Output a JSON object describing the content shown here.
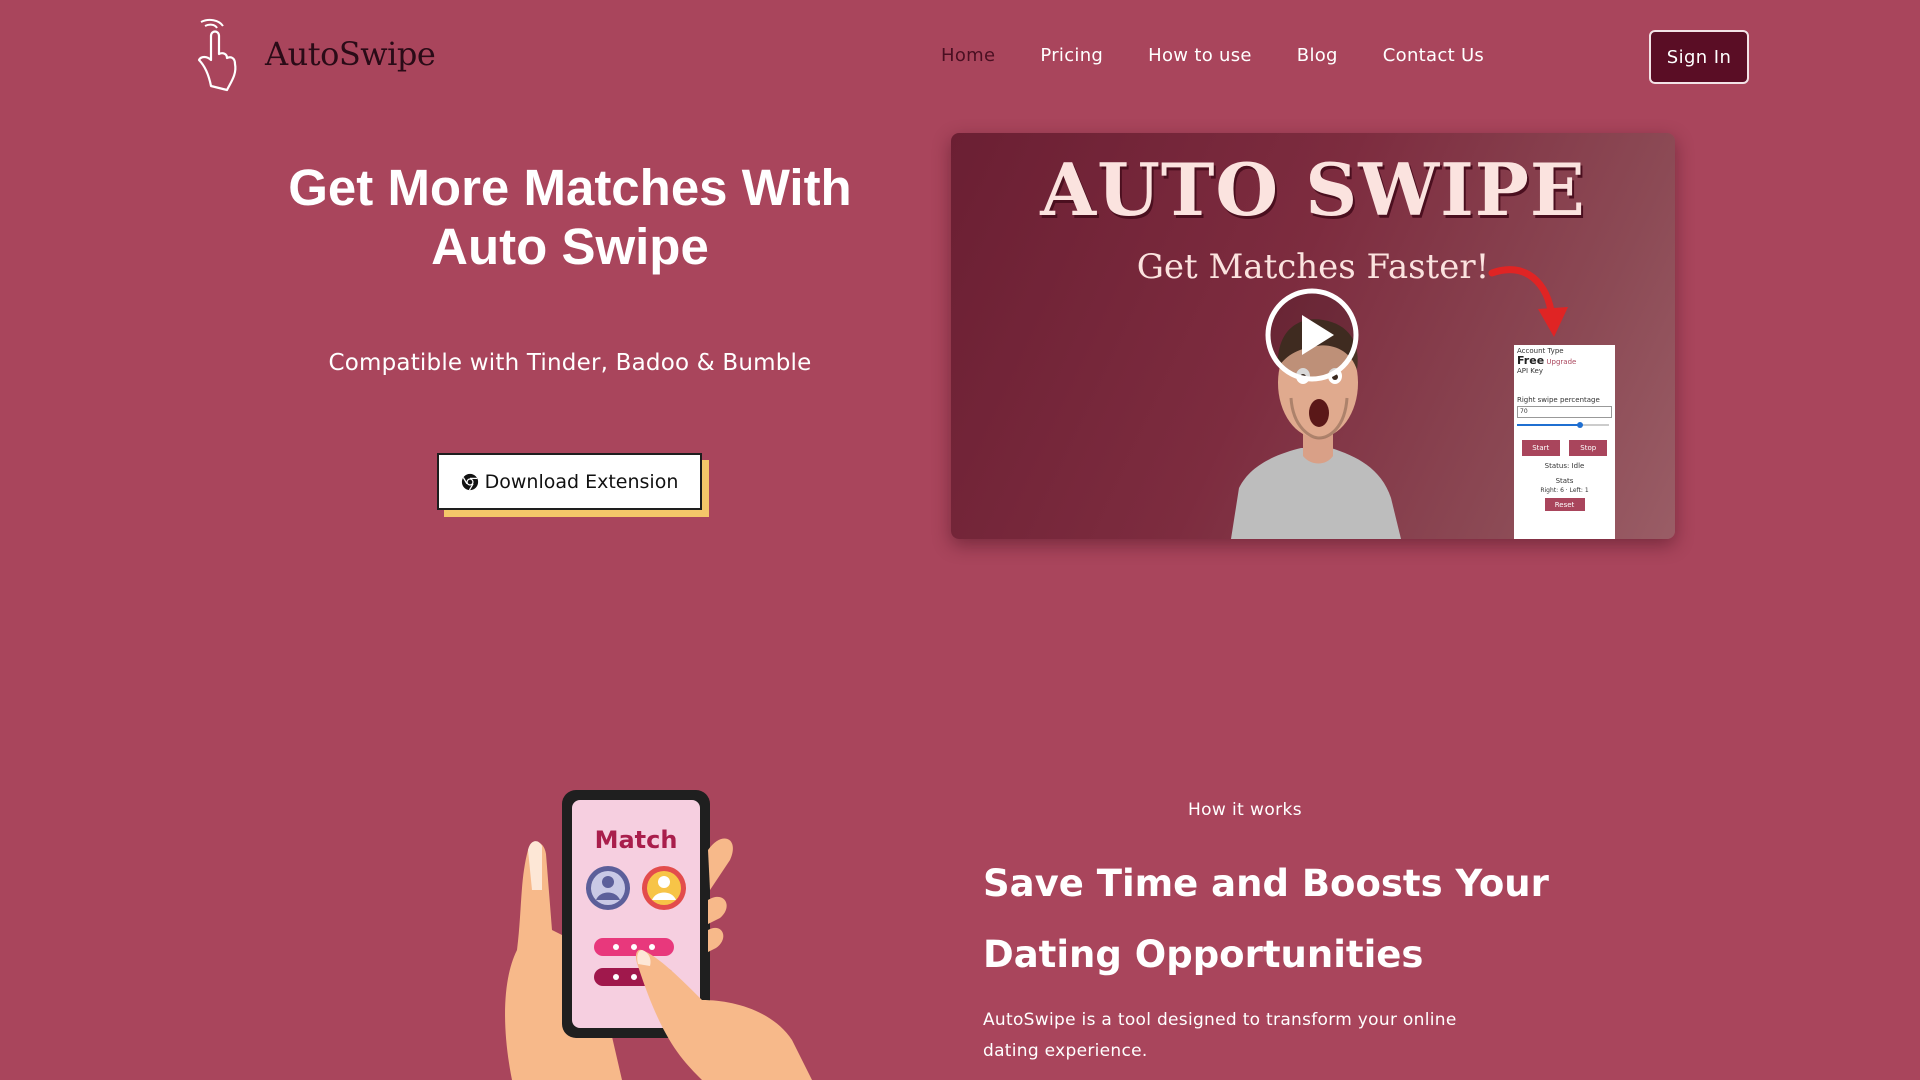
{
  "brand": {
    "name": "AutoSwipe",
    "logo_icon": "tap-hand-icon"
  },
  "nav": {
    "items": [
      {
        "label": "Home",
        "active": true
      },
      {
        "label": "Pricing",
        "active": false
      },
      {
        "label": "How to use",
        "active": false
      },
      {
        "label": "Blog",
        "active": false
      },
      {
        "label": "Contact Us",
        "active": false
      }
    ],
    "signin_label": "Sign In"
  },
  "hero": {
    "title": "Get More Matches With Auto Swipe",
    "compatible": "Compatible with Tinder, Badoo & Bumble",
    "download_label": "Download Extension",
    "download_icon": "chrome-icon"
  },
  "video": {
    "title": "AUTO SWIPE",
    "subtitle": "Get Matches Faster!",
    "play_icon": "play-icon",
    "panel": {
      "account_type_label": "Account Type",
      "plan": "Free",
      "upgrade": "Upgrade",
      "api_key_label": "API Key",
      "right_swipe_label": "Right swipe percentage",
      "right_swipe_value": "70",
      "slider_level": 0.7,
      "start_label": "Start",
      "stop_label": "Stop",
      "status_text": "Status: Idle",
      "stats_label": "Stats",
      "stats_text": "Right: 6 · Left: 1",
      "reset_label": "Reset"
    }
  },
  "how_it_works": {
    "label": "How it works",
    "title": "Save Time and Boosts Your Dating Opportunities",
    "text": "AutoSwipe is a tool designed to transform your online dating experience.",
    "illustration": {
      "match_label": "Match"
    }
  },
  "colors": {
    "background": "#a9455c",
    "dark_accent": "#5a0d25",
    "button_shadow": "#f4c669"
  }
}
